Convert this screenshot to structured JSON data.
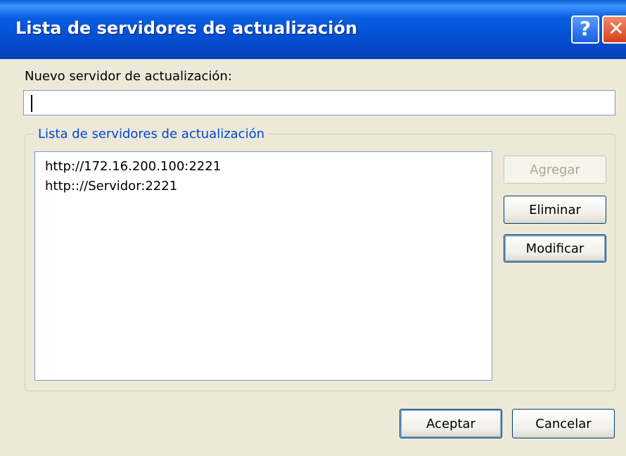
{
  "window": {
    "title": "Lista de servidores de actualización",
    "help_glyph": "?",
    "close_glyph": "✕"
  },
  "new_server": {
    "label": "Nuevo servidor de actualización:",
    "value": ""
  },
  "server_list": {
    "legend": "Lista de servidores de actualización",
    "items": [
      "http://172.16.200.100:2221",
      "http:://Servidor:2221"
    ]
  },
  "buttons": {
    "add": "Agregar",
    "remove": "Eliminar",
    "modify": "Modificar",
    "ok": "Aceptar",
    "cancel": "Cancelar"
  },
  "colors": {
    "titlebar": "#0452d6",
    "dialog_bg": "#ece9d8",
    "group_legend": "#0046d5",
    "close_button": "#d8401a"
  }
}
